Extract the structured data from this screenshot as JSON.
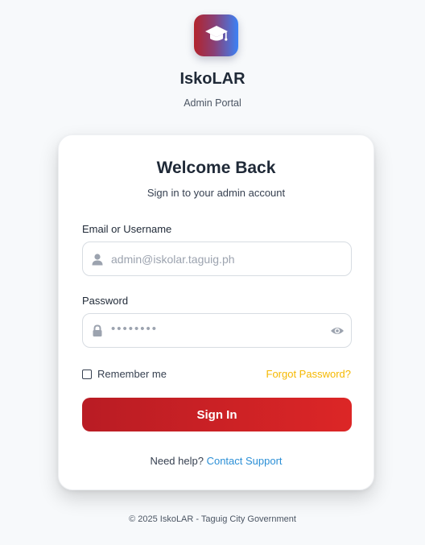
{
  "brand": {
    "name": "IskoLAR",
    "subtitle": "Admin Portal",
    "logo_icon": "graduation-cap-icon",
    "logo_gradient": [
      "#b3242c",
      "#3b82f6"
    ]
  },
  "login": {
    "title": "Welcome Back",
    "subtitle": "Sign in to your admin account",
    "email": {
      "label": "Email or Username",
      "placeholder": "admin@iskolar.taguig.ph",
      "value": "",
      "icon": "user-icon"
    },
    "password": {
      "label": "Password",
      "masked_value": "••••••••",
      "icon": "lock-icon",
      "toggle_icon": "eye-icon"
    },
    "remember_label": "Remember me",
    "remember_checked": false,
    "forgot_label": "Forgot Password?",
    "submit_label": "Sign In",
    "help_prefix": "Need help?",
    "help_link": "Contact Support"
  },
  "colors": {
    "accent_red": "#dc2626",
    "link_blue": "#2b8fd6",
    "forgot_yellow": "#f5b800"
  },
  "footer": {
    "text": "© 2025 IskoLAR - Taguig City Government"
  }
}
